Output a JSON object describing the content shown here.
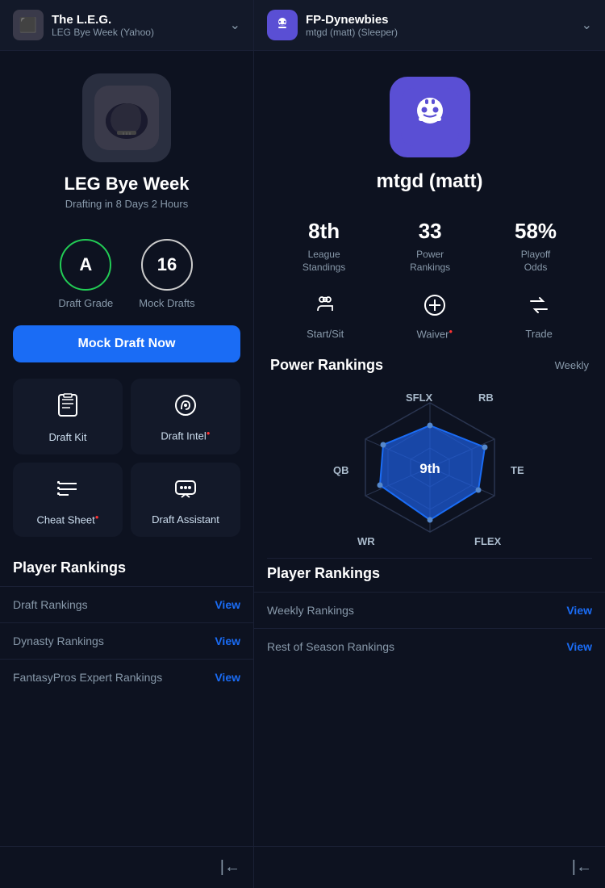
{
  "left": {
    "header": {
      "title": "The L.E.G.",
      "subtitle": "LEG Bye Week (Yahoo)",
      "avatar_emoji": "🏈"
    },
    "league": {
      "name": "LEG Bye Week",
      "meta": "Drafting in 8 Days 2 Hours",
      "logo_emoji": "🏈"
    },
    "stats": [
      {
        "value": "A",
        "label": "Draft Grade",
        "border": "green"
      },
      {
        "value": "16",
        "label": "Mock Drafts",
        "border": "white"
      }
    ],
    "mock_draft_btn": "Mock Draft Now",
    "tools": [
      {
        "icon": "📋",
        "label": "Draft Kit"
      },
      {
        "icon": "📊",
        "label": "Draft Intel",
        "dot": true
      },
      {
        "icon": "☰",
        "label": "Cheat Sheet",
        "dot": true
      },
      {
        "icon": "💬",
        "label": "Draft Assistant"
      }
    ],
    "player_rankings": {
      "title": "Player Rankings",
      "rows": [
        {
          "label": "Draft Rankings",
          "link": "View"
        },
        {
          "label": "Dynasty Rankings",
          "link": "View"
        },
        {
          "label": "FantasyPros Expert Rankings",
          "link": "View"
        }
      ]
    },
    "nav_icon": "⊣"
  },
  "right": {
    "header": {
      "title": "FP-Dynewbies",
      "subtitle": "mtgd (matt) (Sleeper)",
      "avatar_emoji": "🤖"
    },
    "profile": {
      "name": "mtgd (matt)",
      "avatar_emoji": "🤖"
    },
    "stats": [
      {
        "value": "8th",
        "label": "League\nStandings"
      },
      {
        "value": "33",
        "label": "Power\nRankings"
      },
      {
        "value": "58%",
        "label": "Playoff\nOdds"
      }
    ],
    "tools": [
      {
        "icon": "👥",
        "label": "Start/Sit"
      },
      {
        "icon": "⊕",
        "label": "Waiver",
        "dot": true
      },
      {
        "icon": "⇄",
        "label": "Trade"
      }
    ],
    "power_rankings": {
      "title": "Power Rankings",
      "period": "Weekly",
      "rank": "9th",
      "labels": {
        "top_left": "SFLX",
        "top_right": "RB",
        "mid_left": "QB",
        "mid_right": "TE",
        "bot_left": "WR",
        "bot_right": "FLEX"
      }
    },
    "player_rankings": {
      "title": "Player Rankings",
      "rows": [
        {
          "label": "Weekly Rankings",
          "link": "View"
        },
        {
          "label": "Rest of Season Rankings",
          "link": "View"
        }
      ]
    },
    "nav_icon": "⊣"
  }
}
